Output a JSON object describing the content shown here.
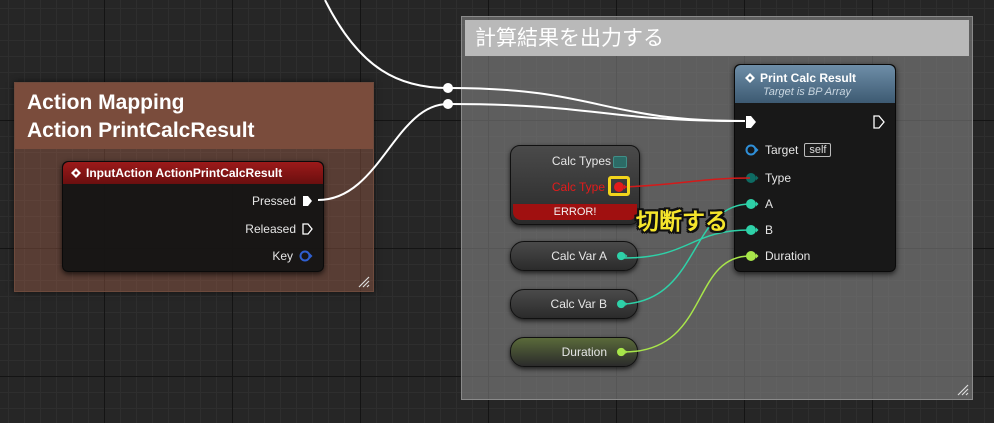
{
  "comments": {
    "left": {
      "line1": "Action Mapping",
      "line2": "Action PrintCalcResult"
    },
    "right": {
      "title": "計算結果を出力する"
    }
  },
  "input_action_node": {
    "title": "InputAction ActionPrintCalcResult",
    "pins": {
      "pressed": "Pressed",
      "released": "Released",
      "key": "Key"
    }
  },
  "print_node": {
    "title": "Print Calc Result",
    "subtitle": "Target is BP Array",
    "pins": {
      "target": "Target",
      "target_default": "self",
      "type": "Type",
      "a": "A",
      "b": "B",
      "duration": "Duration"
    }
  },
  "calc_types_node": {
    "title": "Calc Types",
    "pin": "Calc Type",
    "error": "ERROR!"
  },
  "variables": {
    "a": "Calc Var A",
    "b": "Calc Var B",
    "duration": "Duration"
  },
  "annotation": {
    "text": "切断する"
  },
  "colors": {
    "exec": "#ffffff",
    "struct_pin": "#2f5fd0",
    "enum_pin": "#0e6b63",
    "int_pin": "#2ed1a8",
    "float_pin": "#a8e64a",
    "error_wire": "#d41a1a",
    "annotation": "#f5e52c"
  }
}
